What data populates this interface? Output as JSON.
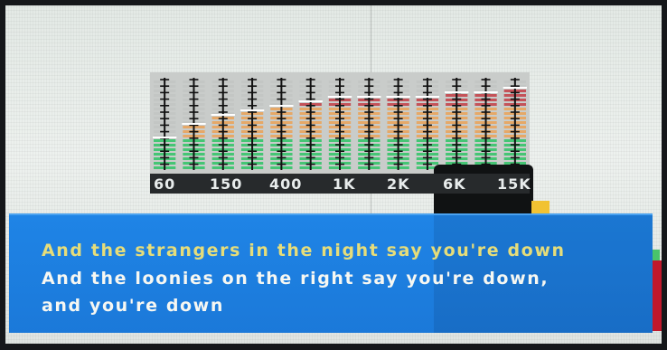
{
  "equalizer": {
    "bands": [
      {
        "label": "60",
        "level": 0.33
      },
      {
        "label": "",
        "level": 0.48
      },
      {
        "label": "150",
        "level": 0.62
      },
      {
        "label": "",
        "level": 0.67
      },
      {
        "label": "400",
        "level": 0.71
      },
      {
        "label": "",
        "level": 0.74
      },
      {
        "label": "1K",
        "level": 0.78
      },
      {
        "label": "",
        "level": 0.78
      },
      {
        "label": "2K",
        "level": 0.8
      },
      {
        "label": "",
        "level": 0.82
      },
      {
        "label": "6K",
        "level": 0.85
      },
      {
        "label": "",
        "level": 0.86
      },
      {
        "label": "15K",
        "level": 0.88
      }
    ],
    "colors": {
      "green": "#36c46a",
      "orange": "#e9a45c",
      "red": "#c3454b",
      "tick": "#111111",
      "base": "#272a2c"
    }
  },
  "lyrics": {
    "line1": "And the strangers in the night say you're down",
    "line2": "And the loonies on the right say you're down,",
    "line3": "and you're down",
    "current_color": "#e6dd7a",
    "text_color": "#f6f7f2",
    "box_color": "#1f84e6"
  }
}
